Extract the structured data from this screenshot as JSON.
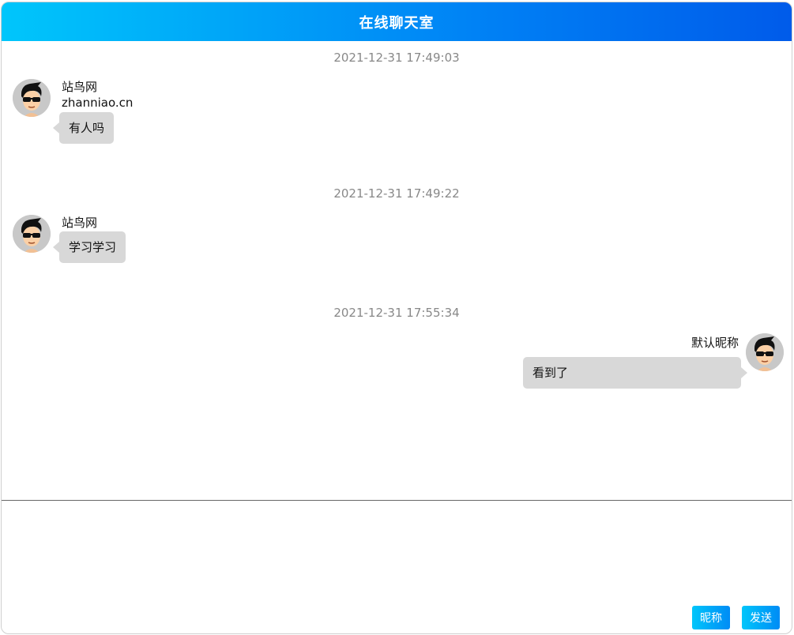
{
  "header": {
    "title": "在线聊天室"
  },
  "messages": [
    {
      "time": "2021-12-31 17:49:03",
      "side": "left",
      "name": "站鸟网",
      "name_line2": "zhanniao.cn",
      "text": "有人吗",
      "avatar_icon": "avatar-sunglasses-icon"
    },
    {
      "time": "2021-12-31 17:49:22",
      "side": "left",
      "name": "站鸟网",
      "text": "学习学习",
      "avatar_icon": "avatar-sunglasses-icon"
    },
    {
      "time": "2021-12-31 17:55:34",
      "side": "right",
      "name": "默认昵称",
      "text": "看到了",
      "avatar_icon": "avatar-sunglasses-icon"
    }
  ],
  "composer": {
    "value": "",
    "placeholder": ""
  },
  "buttons": {
    "nickname_label": "昵称",
    "send_label": "发送"
  },
  "colors": {
    "header_gradient_start": "#00c6fb",
    "header_gradient_end": "#005bea",
    "bubble_bg": "#d8d8d8",
    "timestamp": "#888888"
  }
}
